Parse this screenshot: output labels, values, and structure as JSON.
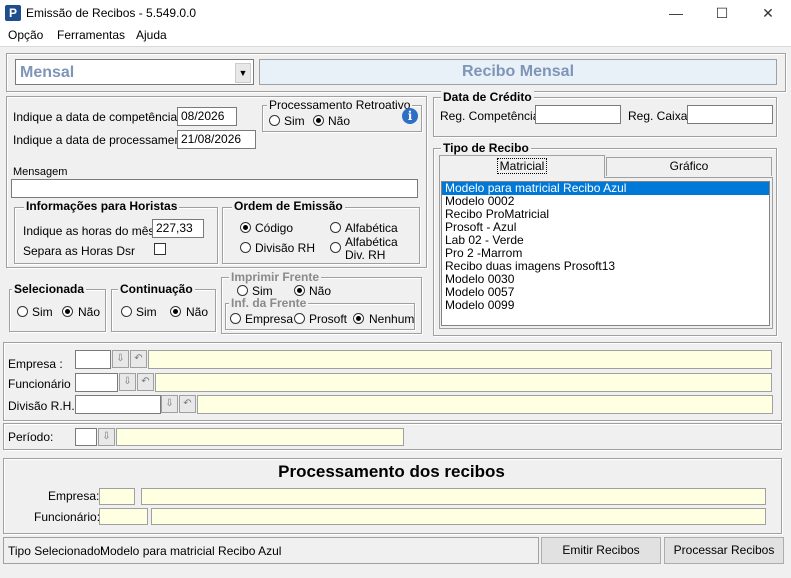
{
  "window": {
    "title": "Emissão de Recibos - 5.549.0.0",
    "min": "—",
    "max": "☐",
    "close": "✕"
  },
  "menu": [
    "Opção",
    "Ferramentas",
    "Ajuda"
  ],
  "recibo_type_select": "Mensal",
  "recibo_header": "Recibo Mensal",
  "datas": {
    "competencia_label": "Indique a data de competência",
    "competencia_value": "08/2026",
    "processamento_label": "Indique a data de processamento",
    "processamento_value": "21/08/2026"
  },
  "retroativo": {
    "legend": "Processamento Retroativo",
    "sim": "Sim",
    "nao": "Não",
    "info": "i"
  },
  "credito": {
    "legend": "Data de Crédito",
    "reg_competencia": "Reg. Competência",
    "reg_caixa": "Reg. Caixa"
  },
  "mensagem": {
    "label": "Mensagem",
    "value": ""
  },
  "horistas": {
    "legend": "Informações para Horistas",
    "horas_label": "Indique as horas do mês",
    "horas_value": "227,33",
    "dsr_label": "Separa as Horas Dsr"
  },
  "ordem": {
    "legend": "Ordem de Emissão",
    "codigo": "Código",
    "alfabetica": "Alfabética",
    "divisao": "Divisão RH",
    "alfabetica_div": "Alfabética",
    "alfabetica_div2": "Div.  RH"
  },
  "tipo_recibo": {
    "legend": "Tipo de Recibo",
    "tab_matricial": "Matricial",
    "tab_grafico": "Gráfico",
    "items": [
      "Modelo para matricial Recibo Azul",
      "Modelo 0002",
      "Recibo ProMatricial",
      "Prosoft - Azul",
      "Lab 02 - Verde",
      "Pro 2 -Marrom",
      "Recibo duas imagens Prosoft13",
      "Modelo 0030",
      "Modelo 0057",
      "Modelo 0099"
    ]
  },
  "selecionada": {
    "legend": "Selecionada",
    "sim": "Sim",
    "nao": "Não"
  },
  "continuacao": {
    "legend": "Continuação",
    "sim": "Sim",
    "nao": "Não"
  },
  "imprimir_frente": {
    "legend": "Imprimir Frente",
    "sim": "Sim",
    "nao": "Não"
  },
  "inf_frente": {
    "legend": "Inf. da Frente",
    "empresa": "Empresa",
    "prosoft": "Prosoft",
    "nenhum": "Nenhum"
  },
  "filtros": {
    "empresa": "Empresa :",
    "funcionario": "Funcionário :",
    "divisao": "Divisão R.H.:",
    "periodo": "Período:"
  },
  "processamento": {
    "title": "Processamento dos recibos",
    "empresa": "Empresa:",
    "funcionario": "Funcionário:"
  },
  "status": {
    "label": "Tipo Selecionado:",
    "value": "Modelo para matricial Recibo Azul"
  },
  "buttons": {
    "emitir": "Emitir Recibos",
    "processar": "Processar Recibos"
  }
}
